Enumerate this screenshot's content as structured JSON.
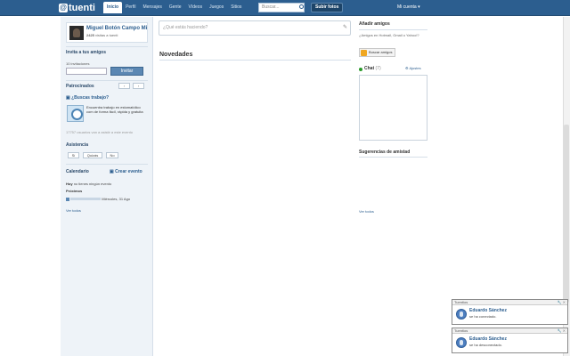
{
  "topbar": {
    "logo_mark": "@",
    "logo_text": "tuenti",
    "nav": [
      {
        "label": "Inicio",
        "active": true
      },
      {
        "label": "Perfil"
      },
      {
        "label": "Mensajes"
      },
      {
        "label": "Gente"
      },
      {
        "label": "Vídeos"
      },
      {
        "label": "Juegos"
      },
      {
        "label": "Sitios"
      }
    ],
    "search_placeholder": "Buscar...",
    "upload_label": "Subir fotos",
    "account_label": "Mi cuenta ▾"
  },
  "profile": {
    "name": "Miguel Botón Campo Mi",
    "stats_prefix": "2425",
    "stats_suffix": "visitas a tuenti"
  },
  "invite": {
    "title": "Invita a tus amigos",
    "count_label": "10 invitaciones",
    "button": "Invitar"
  },
  "sponsored": {
    "title": "Patrocinados",
    "prev": "‹",
    "next": "›",
    "ad_title": "¿Buscas trabajo?",
    "ad_text": "Encuentra trabajo en estomatólico com de forma fácil, rápida y gratuita",
    "ad_note": "17757 usuarios van a asistir a este evento",
    "attend_title": "Asistencia",
    "attend_yes": "Sí",
    "attend_maybe": "Quizás",
    "attend_no": "No"
  },
  "calendar": {
    "title": "Calendario",
    "create": "Crear evento",
    "today_label": "Hoy",
    "today_text": "no tienes ningún evento",
    "next_label": "Próximos",
    "next_text": "Miércoles, 31 Ago",
    "see_all": "Ver todos"
  },
  "main": {
    "status_placeholder": "¿Qué estás haciendo?",
    "news_title": "Novedades"
  },
  "right": {
    "add_friends_title": "Añadir amigos",
    "add_friends_text": "¿Amigos en Hotmail, Gmail o Yahoo!?",
    "find_button": "Buscar amigos",
    "chat_title": "Chat",
    "chat_count": "(7)",
    "chat_options": "⚙ Ajustes",
    "suggestions_title": "Sugerencias de amistad",
    "see_all": "Ver todos"
  },
  "notifications": [
    {
      "header": "Tuentios",
      "name": "Eduardo Sánchez",
      "message": "se ha conectado."
    },
    {
      "header": "Tuentios",
      "name": "Eduardo Sánchez",
      "message": "se ha desconectado."
    }
  ],
  "notification_tools": "🔧 ✕"
}
